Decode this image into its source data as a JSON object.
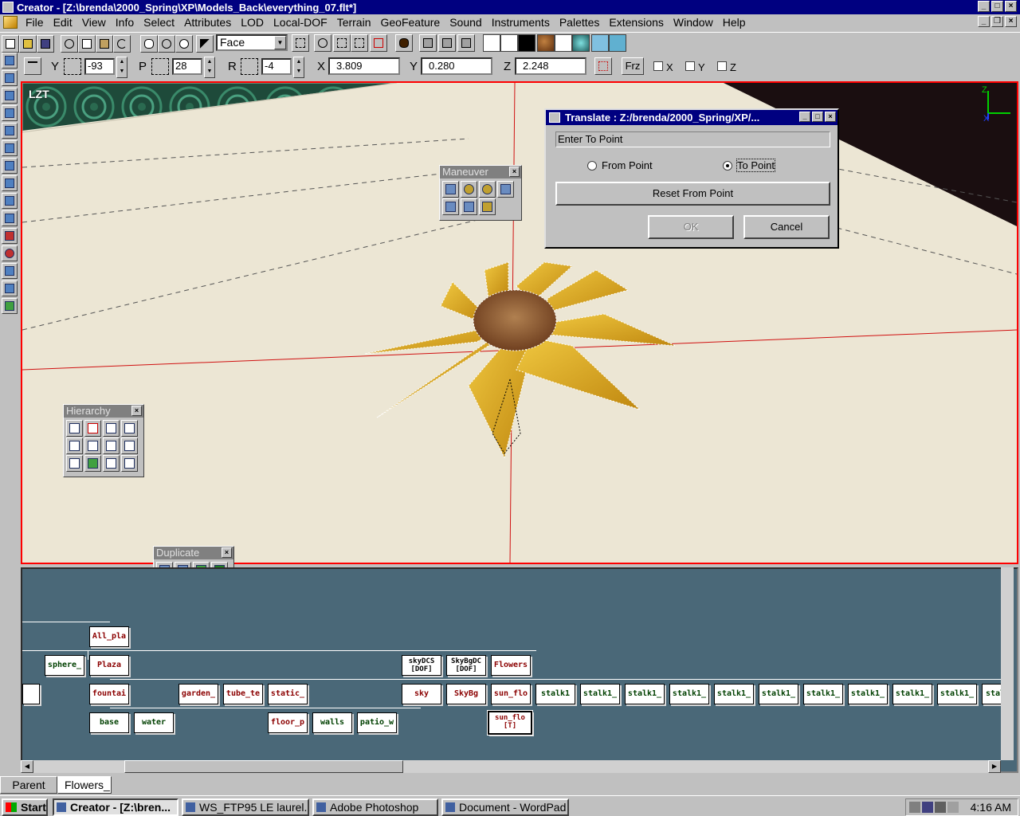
{
  "window": {
    "title": "Creator - [Z:\\brenda\\2000_Spring\\XP\\Models_Back\\everything_07.flt*]"
  },
  "menu": [
    "File",
    "Edit",
    "View",
    "Info",
    "Select",
    "Attributes",
    "LOD",
    "Local-DOF",
    "Terrain",
    "GeoFeature",
    "Sound",
    "Instruments",
    "Palettes",
    "Extensions",
    "Window",
    "Help"
  ],
  "toolbar": {
    "select_mode": "Face"
  },
  "transform": {
    "yaw_label": "Y",
    "yaw": "-93",
    "pitch_label": "P",
    "pitch": "28",
    "roll_label": "R",
    "roll": "-4",
    "x_label": "X",
    "x": "3.809",
    "y_label": "Y",
    "y": "0.280",
    "z_label": "Z",
    "z": "2.248",
    "frz_label": "Frz",
    "lock_x": "X",
    "lock_y": "Y",
    "lock_z": "Z"
  },
  "viewport": {
    "view_label": "LZT",
    "axis_z": "Z",
    "axis_x": "X"
  },
  "palettes": {
    "maneuver": "Maneuver",
    "hierarchy": "Hierarchy",
    "duplicate": "Duplicate"
  },
  "dialog": {
    "title": "Translate : Z:/brenda/2000_Spring/XP/...",
    "prompt": "Enter To Point",
    "from_point": "From Point",
    "to_point": "To Point",
    "reset": "Reset From Point",
    "ok": "OK",
    "cancel": "Cancel",
    "selected": "to_point"
  },
  "hierarchy_nodes": {
    "row1": [
      "All_pla"
    ],
    "row2": [
      "sphere_",
      "Plaza",
      "Flowers"
    ],
    "dcs": [
      {
        "name": "skyDCS",
        "tag": "[DOF]"
      },
      {
        "name": "SkyBgDC",
        "tag": "[DOF]"
      }
    ],
    "row3": [
      "fountai",
      "garden_",
      "tube_te",
      "static_",
      "sky",
      "SkyBg",
      "sun_flo",
      "stalk1",
      "stalk1_",
      "stalk1_",
      "stalk1_",
      "stalk1_",
      "stalk1_",
      "stalk1_",
      "stalk1_",
      "stalk1_",
      "stalk1_",
      "stal"
    ],
    "row4": [
      "base",
      "water",
      "floor_p",
      "walls",
      "patio_w"
    ],
    "selected": {
      "name": "sun_flo",
      "tag": "[T]"
    }
  },
  "tabs": [
    "Parent",
    "Flowers_"
  ],
  "taskbar": {
    "start": "Start",
    "tasks": [
      "Creator - [Z:\\bren...",
      "WS_FTP95 LE laurel....",
      "Adobe Photoshop",
      "Document - WordPad"
    ],
    "clock": "4:16 AM"
  },
  "colors": {
    "titlebar": "#000080",
    "viewport_bg": "#ece6d4",
    "hierarchy_bg": "#4a6878",
    "petal": "#e8b020"
  }
}
